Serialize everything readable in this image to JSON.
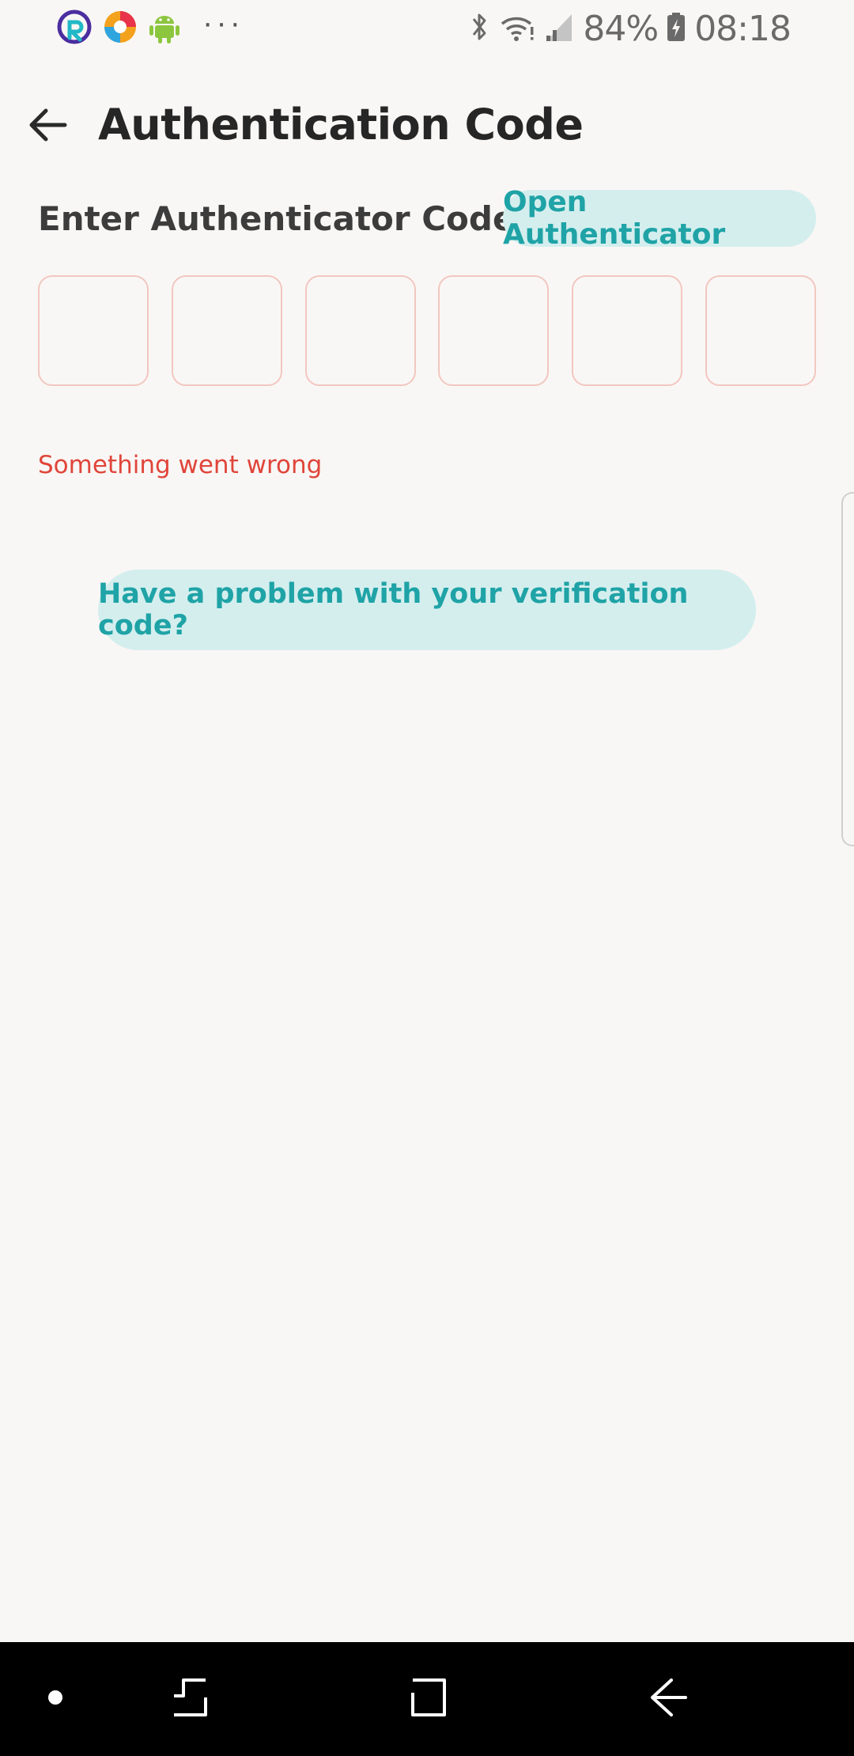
{
  "status_bar": {
    "battery": "84%",
    "time": "08:18",
    "more_indicator": "···",
    "icons": [
      "app-r-icon",
      "browser-icon",
      "android-icon",
      "bluetooth-icon",
      "wifi-icon",
      "signal-icon",
      "battery-charging-icon"
    ]
  },
  "header": {
    "title": "Authentication Code",
    "back_icon": "arrow-left-icon"
  },
  "code_section": {
    "label": "Enter Authenticator Code",
    "open_button": "Open Authenticator",
    "digits": [
      "",
      "",
      "",
      "",
      "",
      ""
    ]
  },
  "error_message": "Something went wrong",
  "help_button": "Have a problem with your verification code?",
  "nav_bar": {
    "icons": [
      "dot-icon",
      "recent-apps-icon",
      "home-icon",
      "back-icon"
    ]
  },
  "colors": {
    "background": "#f9f7f5",
    "accent": "#1fa3a6",
    "accent_bg": "#d4eeee",
    "error": "#e0453a",
    "box_border": "#f2c7c0"
  }
}
